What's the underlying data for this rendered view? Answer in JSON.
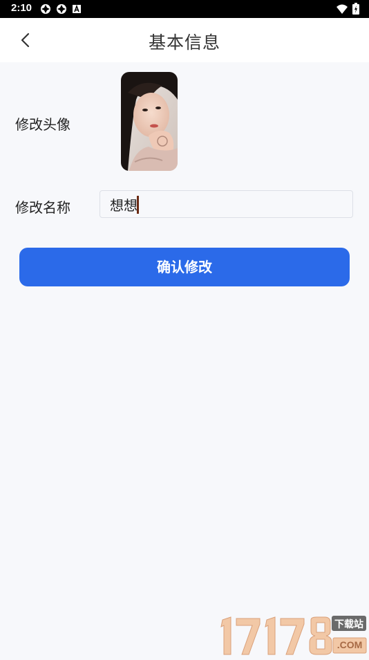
{
  "status_bar": {
    "time": "2:10",
    "left_icons": [
      "app-notification-icon",
      "app-notification-icon",
      "a-badge-icon"
    ],
    "right_icons": [
      "wifi-icon",
      "battery-charging-icon"
    ]
  },
  "header": {
    "title": "基本信息",
    "back_icon": "chevron-left-icon"
  },
  "form": {
    "avatar_label": "修改头像",
    "name_label": "修改名称",
    "name_value": "想想"
  },
  "confirm_button": {
    "label": "确认修改",
    "color": "#2b6ae9"
  },
  "watermark": {
    "brand": "17178",
    "tag": "下载站",
    "domain": ".COM"
  },
  "colors": {
    "background": "#f7f8fb",
    "header_bg": "#ffffff",
    "accent": "#2b6ae9"
  }
}
